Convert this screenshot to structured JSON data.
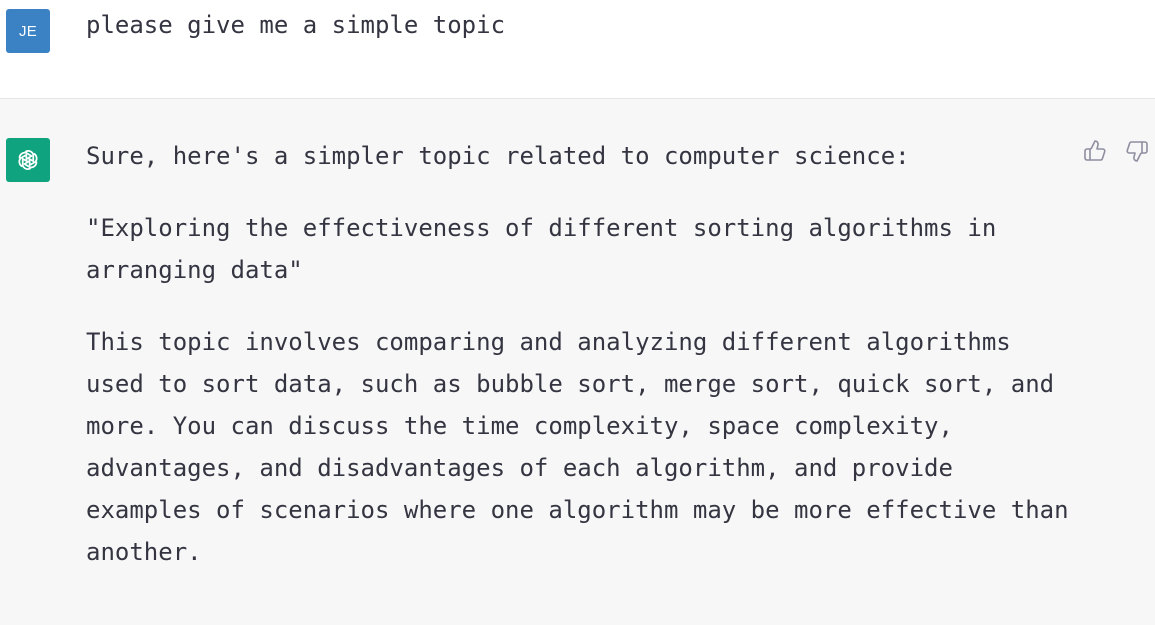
{
  "user_message": {
    "avatar_initials": "JE",
    "text": "please give me a simple topic"
  },
  "assistant_message": {
    "paragraphs": [
      "Sure, here's a simpler topic related to computer science:",
      "\"Exploring the effectiveness of different sorting algorithms in arranging data\"",
      "This topic involves comparing and analyzing different algorithms used to sort data, such as bubble sort, merge sort, quick sort, and more. You can discuss the time complexity, space complexity, advantages, and disadvantages of each algorithm, and provide examples of scenarios where one algorithm may be more effective than another."
    ]
  },
  "icons": {
    "assistant_avatar": "openai-logo-icon",
    "thumbs_up": "thumbs-up-icon",
    "thumbs_down": "thumbs-down-icon"
  },
  "colors": {
    "user_avatar_bg": "#3b82c4",
    "assistant_avatar_bg": "#10a37f",
    "assistant_row_bg": "#f7f7f8",
    "text": "#343541"
  }
}
